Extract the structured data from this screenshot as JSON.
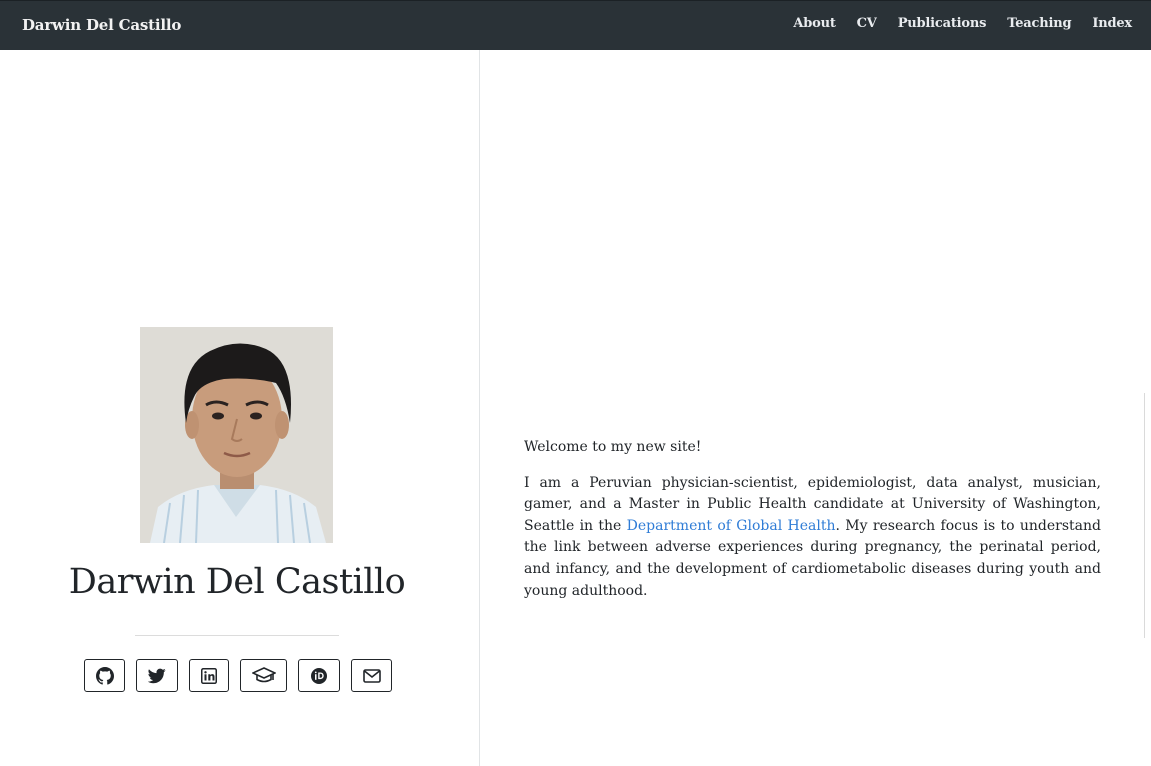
{
  "navbar": {
    "brand": "Darwin Del Castillo",
    "links": [
      "About",
      "CV",
      "Publications",
      "Teaching",
      "Index"
    ]
  },
  "sidebar": {
    "name": "Darwin Del Castillo",
    "social_icons": [
      "github-icon",
      "twitter-icon",
      "linkedin-icon",
      "graduation-cap-icon",
      "orcid-icon",
      "envelope-icon"
    ]
  },
  "content": {
    "welcome": "Welcome to my new site!",
    "bio_before_link": "I am a Peruvian physician-scientist, epidemiologist, data analyst, musician, gamer, and a Master in Public Health candidate at University of Washington, Seattle in the ",
    "bio_link": "Department of Global Health",
    "bio_after_link": ". My research focus is to understand the link between adverse experiences during pregnancy, the perinatal period, and infancy, and the development of cardiometabolic diseases during youth and young adulthood."
  },
  "colors": {
    "navbar_bg": "#2a3237",
    "link": "#2f7cd6",
    "text": "#212529"
  }
}
